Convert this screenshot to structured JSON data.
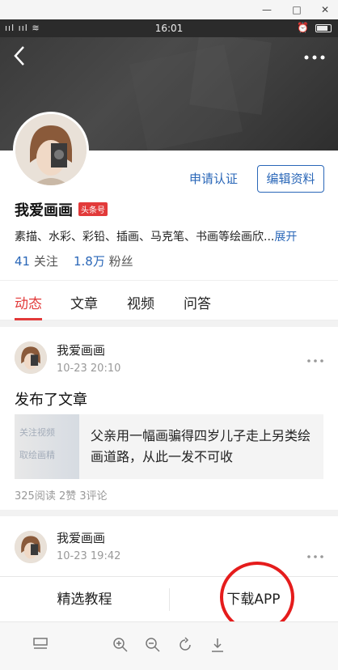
{
  "status": {
    "signal": "ııl ııl ≋",
    "time": "16:01",
    "alarm": "⏰"
  },
  "window": {
    "minimize": "—",
    "maximize": "□",
    "close": "✕"
  },
  "header": {
    "back_icon": "chevron-left-icon",
    "more_icon": "more-horizontal-icon"
  },
  "profile": {
    "name": "我爱画画",
    "badge": "头条号",
    "verify_label": "申请认证",
    "edit_label": "编辑资料",
    "bio": "素描、水彩、彩铅、插画、马克笔、书画等绘画欣...",
    "bio_expand": "展开",
    "following_count": "41",
    "following_label": "关注",
    "followers_count": "1.8万",
    "followers_label": "粉丝"
  },
  "tabs": [
    {
      "label": "动态",
      "active": true
    },
    {
      "label": "文章",
      "active": false
    },
    {
      "label": "视频",
      "active": false
    },
    {
      "label": "问答",
      "active": false
    }
  ],
  "feed": [
    {
      "author": "我爱画画",
      "time": "10-23 20:10",
      "text": "发布了文章",
      "article_title": "父亲用一幅画骗得四岁儿子走上另类绘画道路，从此一发不可收",
      "thumb_text_1": "关注视频",
      "thumb_text_2": "取绘画精",
      "meta": "325阅读 2赞 3评论"
    },
    {
      "author": "我爱画画",
      "time": "10-23 19:42"
    }
  ],
  "bottom_bar": {
    "left_label": "精选教程",
    "right_label": "下载APP"
  },
  "colors": {
    "accent": "#2a67b8",
    "active_tab": "#e23a3a",
    "annotation_circle": "#e51c1c"
  }
}
